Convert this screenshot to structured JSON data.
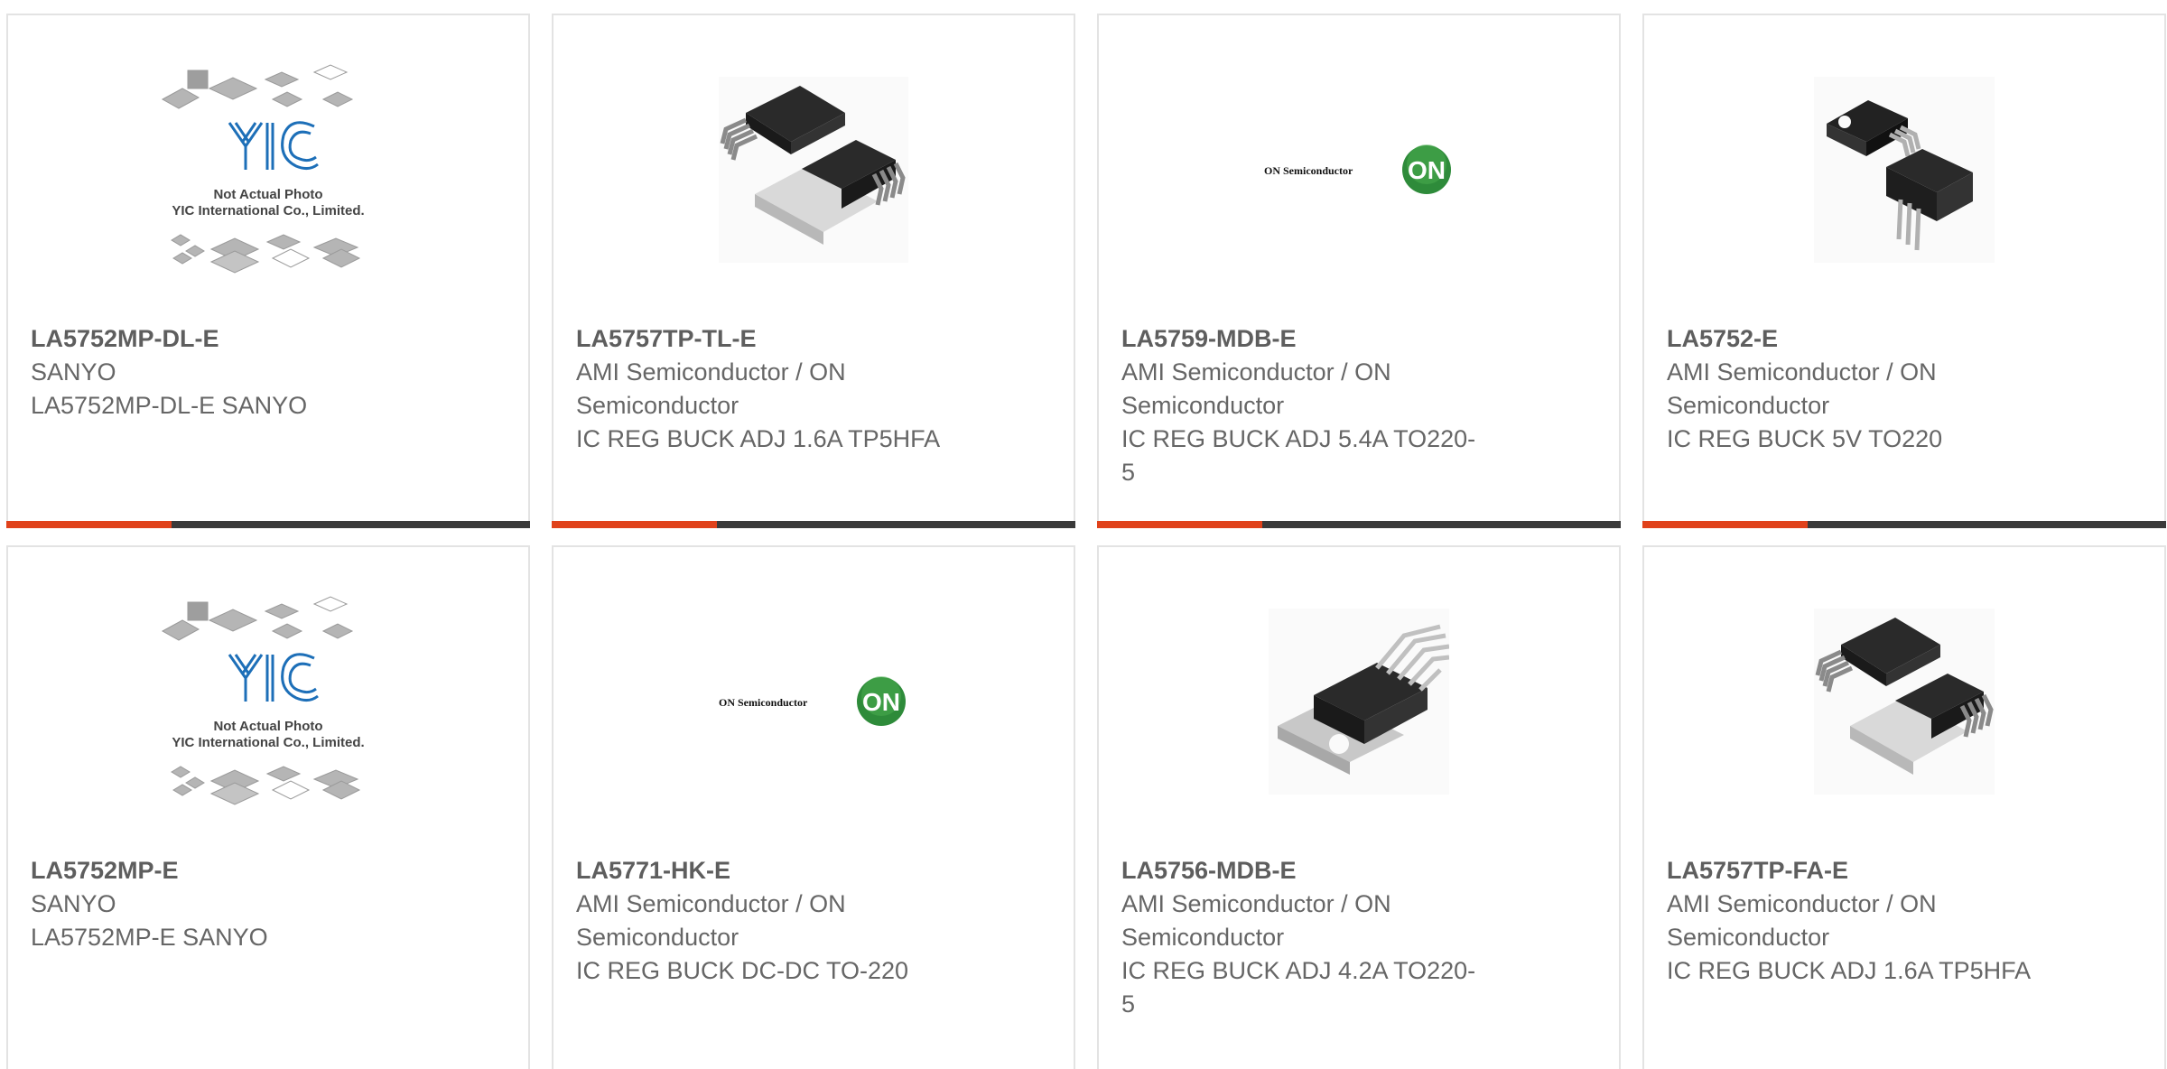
{
  "products": [
    {
      "part_number": "LA5752MP-DL-E",
      "manufacturer": "SANYO",
      "description": "LA5752MP-DL-E SANYO",
      "image": "yic-placeholder",
      "image_caption_1": "Not Actual Photo",
      "image_caption_2": "YIC International Co., Limited.",
      "image_logo": "YIC"
    },
    {
      "part_number": "LA5757TP-TL-E",
      "manufacturer_line1": "AMI Semiconductor / ON",
      "manufacturer_line2": "Semiconductor",
      "description": "IC REG BUCK ADJ 1.6A TP5HFA",
      "image": "to263-package-photo"
    },
    {
      "part_number": "LA5759-MDB-E",
      "manufacturer_line1": "AMI Semiconductor / ON",
      "manufacturer_line2": "Semiconductor",
      "description_line1": "IC REG BUCK ADJ 5.4A TO220-",
      "description_line2": "5",
      "image": "on-semiconductor-logo",
      "logo_text": "ON Semiconductor",
      "logo_badge": "ON"
    },
    {
      "part_number": "LA5752-E",
      "manufacturer_line1": "AMI Semiconductor / ON",
      "manufacturer_line2": "Semiconductor",
      "description": "IC REG BUCK 5V TO220",
      "image": "to220-package-photo"
    },
    {
      "part_number": "LA5752MP-E",
      "manufacturer": "SANYO",
      "description": "LA5752MP-E SANYO",
      "image": "yic-placeholder",
      "image_caption_1": "Not Actual Photo",
      "image_caption_2": "YIC International Co., Limited.",
      "image_logo": "YIC"
    },
    {
      "part_number": "LA5771-HK-E",
      "manufacturer_line1": "AMI Semiconductor / ON",
      "manufacturer_line2": "Semiconductor",
      "description": "IC REG BUCK DC-DC TO-220",
      "image": "on-semiconductor-logo",
      "logo_text": "ON Semiconductor",
      "logo_badge": "ON"
    },
    {
      "part_number": "LA5756-MDB-E",
      "manufacturer_line1": "AMI Semiconductor / ON",
      "manufacturer_line2": "Semiconductor",
      "description_line1": "IC REG BUCK ADJ 4.2A TO220-",
      "description_line2": "5",
      "image": "to220-5-package-photo"
    },
    {
      "part_number": "LA5757TP-FA-E",
      "manufacturer_line1": "AMI Semiconductor / ON",
      "manufacturer_line2": "Semiconductor",
      "description": "IC REG BUCK ADJ 1.6A TP5HFA",
      "image": "to263-package-photo"
    }
  ],
  "colors": {
    "accent": "#e0421b",
    "bar": "#3a3a3a",
    "border": "#e3e3e3",
    "text": "#666666",
    "yic_blue": "#1d6fb8",
    "on_green": "#2e8b3a"
  }
}
